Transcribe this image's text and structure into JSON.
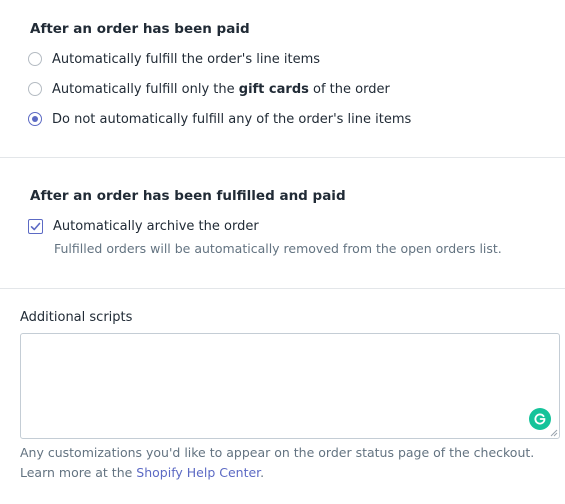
{
  "paid_section": {
    "heading": "After an order has been paid",
    "options": [
      {
        "label": "Automatically fulfill the order's line items",
        "checked": false
      },
      {
        "label_before": "Automatically fulfill only the ",
        "label_bold": "gift cards",
        "label_after": " of the order",
        "checked": false
      },
      {
        "label": "Do not automatically fulfill any of the order's line items",
        "checked": true
      }
    ]
  },
  "fulfilled_section": {
    "heading": "After an order has been fulfilled and paid",
    "archive_label": "Automatically archive the order",
    "archive_checked": true,
    "help_text": "Fulfilled orders will be automatically removed from the open orders list."
  },
  "scripts_section": {
    "label": "Additional scripts",
    "value": "",
    "footer_line1": "Any customizations you'd like to appear on the order status page of the checkout.",
    "footer_prefix": "Learn more at the ",
    "footer_link": "Shopify Help Center",
    "footer_suffix": "."
  },
  "colors": {
    "accent": "#5c6ac4",
    "grammarly": "#15c39a",
    "subdued_text": "#637381"
  },
  "icons": {
    "checkbox": "checkmark-icon",
    "grammarly": "grammarly-icon",
    "resize": "resize-grip-icon"
  }
}
